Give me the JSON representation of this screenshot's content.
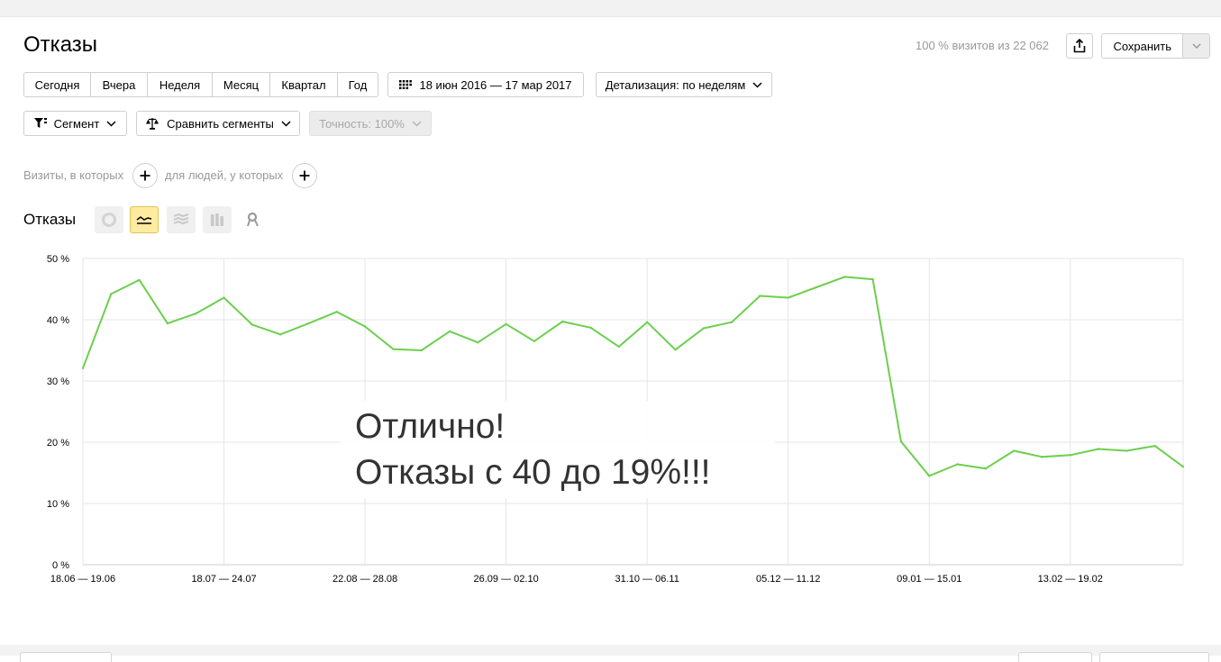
{
  "page": {
    "title": "Отказы",
    "visits_info": "100 % визитов из 22 062",
    "save_label": "Сохранить"
  },
  "periods": [
    "Сегодня",
    "Вчера",
    "Неделя",
    "Месяц",
    "Квартал",
    "Год"
  ],
  "date_range": "18 июн 2016 — 17 мар 2017",
  "detail": "Детализация: по неделям",
  "segment_label": "Сегмент",
  "compare_label": "Сравнить сегменты",
  "accuracy_label": "Точность: 100%",
  "filters": {
    "visits_label": "Визиты, в которых",
    "people_label": "для людей, у которых"
  },
  "chart_title": "Отказы",
  "chart_types": [
    "pie-icon",
    "line-icon",
    "area-icon",
    "bar-icon",
    "map-icon"
  ],
  "chart_types_active": "line-icon",
  "overlay": {
    "line1": "Отлично!",
    "line2": "Отказы с 40 до 19%!!!"
  },
  "colors": {
    "line": "#6ccf4e",
    "active_toggle": "#ffeba0",
    "grid": "#e6e6e6"
  },
  "chart_data": {
    "type": "line",
    "title": "Отказы",
    "ylim": [
      0,
      50
    ],
    "y_ticks": [
      "0 %",
      "10 %",
      "20 %",
      "30 %",
      "40 %",
      "50 %"
    ],
    "x_ticks": [
      "18.06 — 19.06",
      "18.07 — 24.07",
      "22.08 — 28.08",
      "26.09 — 02.10",
      "31.10 — 06.11",
      "05.12 — 11.12",
      "09.01 — 15.01",
      "13.02 — 19.02"
    ],
    "grid": true,
    "series": [
      {
        "values": [
          32.1,
          44.2,
          46.5,
          39.4,
          41.0,
          43.6,
          39.2,
          37.6,
          39.4,
          41.3,
          38.9,
          35.2,
          35.0,
          38.1,
          36.3,
          39.3,
          36.5,
          39.7,
          38.7,
          35.6,
          39.6,
          35.1,
          38.6,
          39.6,
          43.9,
          43.6,
          45.3,
          47.0,
          46.6,
          20.1,
          14.5,
          16.4,
          15.7,
          18.6,
          17.6,
          17.9,
          18.9,
          18.6,
          19.4,
          16.0
        ]
      }
    ]
  }
}
